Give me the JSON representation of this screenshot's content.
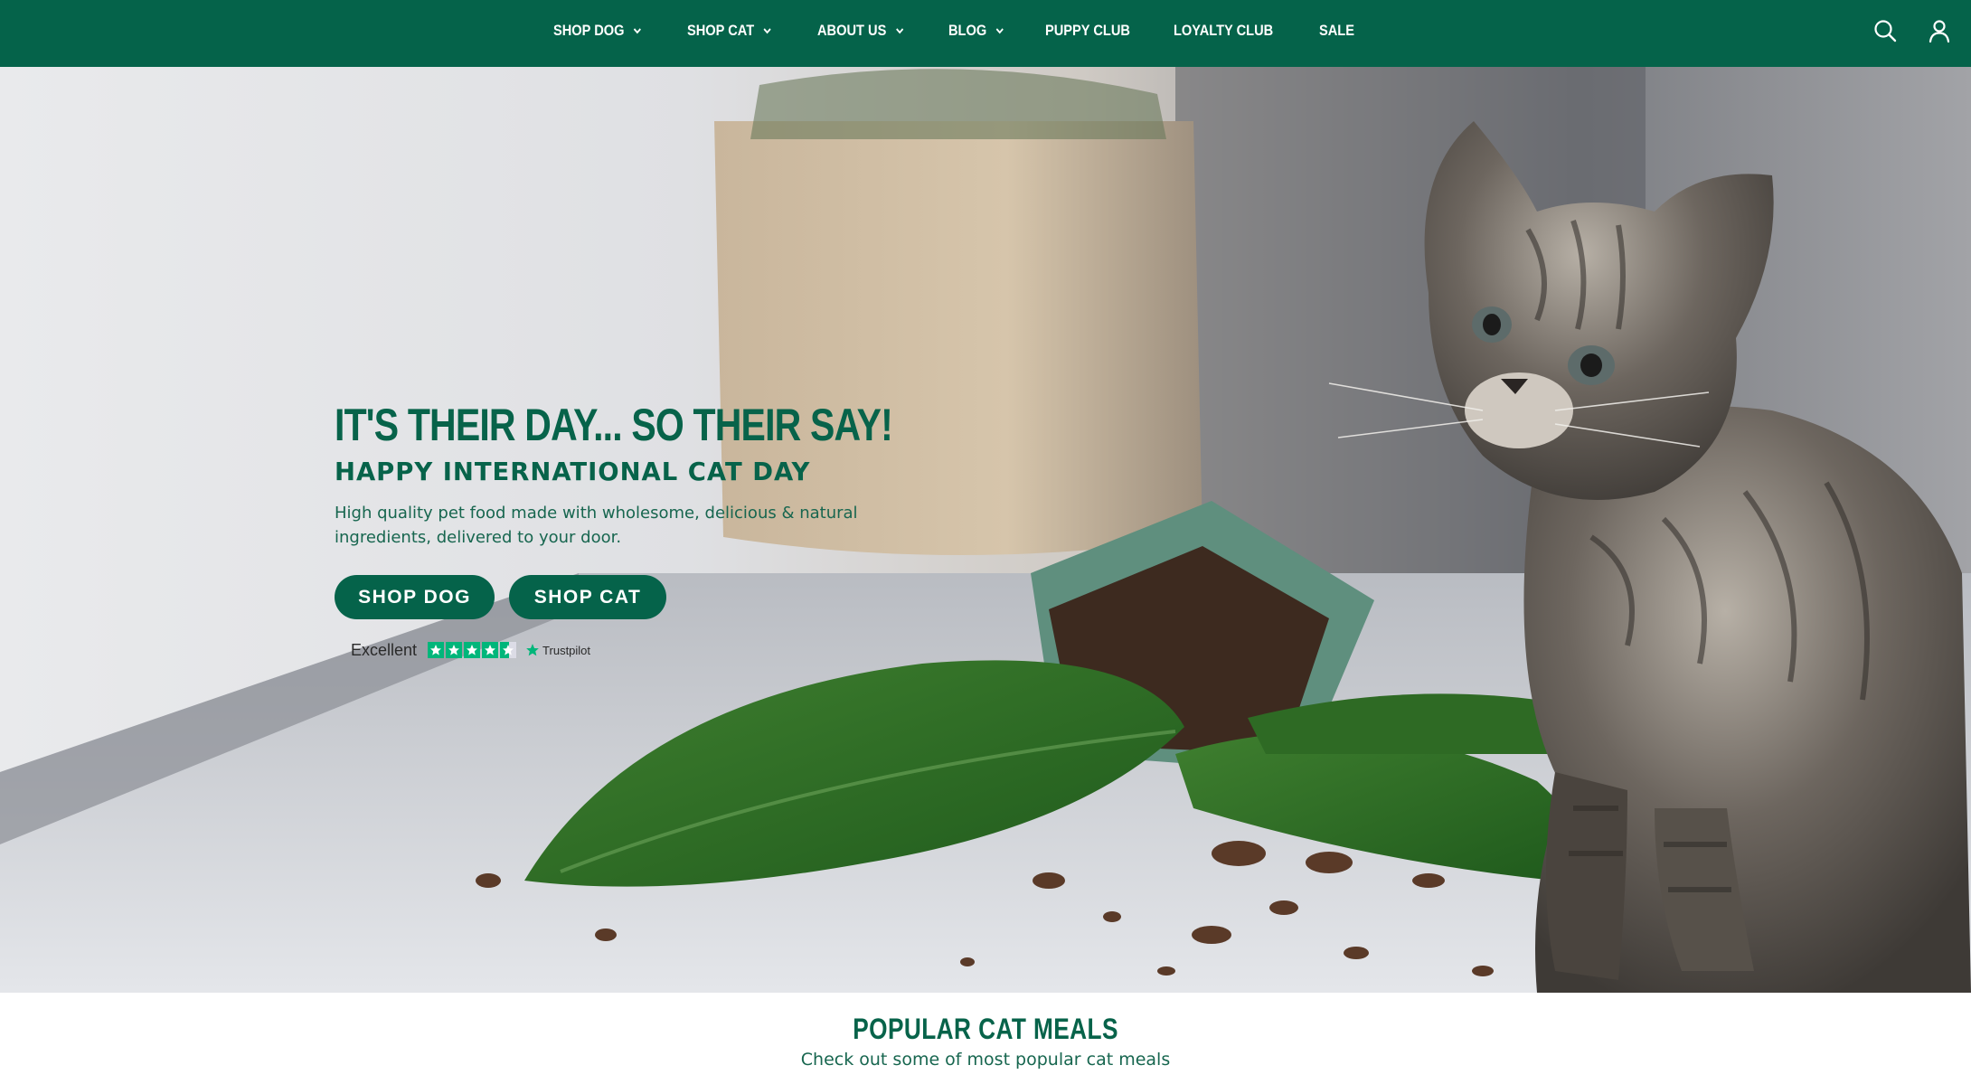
{
  "header": {
    "nav": [
      {
        "label": "SHOP DOG",
        "dropdown": true
      },
      {
        "label": "SHOP CAT",
        "dropdown": true
      },
      {
        "label": "ABOUT US",
        "dropdown": true
      },
      {
        "label": "BLOG",
        "dropdown": true
      },
      {
        "label": "PUPPY CLUB",
        "dropdown": false
      },
      {
        "label": "LOYALTY CLUB",
        "dropdown": false
      },
      {
        "label": "SALE",
        "dropdown": false
      }
    ],
    "icons": [
      "search-icon",
      "account-icon"
    ]
  },
  "hero": {
    "title": "IT'S THEIR DAY... SO THEIR SAY!",
    "subtitle": "HAPPY INTERNATIONAL CAT DAY",
    "description": "High quality pet food made with wholesome, delicious & natural ingredients, delivered to your door.",
    "buttons": {
      "shop_dog": "SHOP DOG",
      "shop_cat": "SHOP CAT"
    },
    "trustpilot": {
      "rating_label": "Excellent",
      "brand": "Trustpilot",
      "stars": 4.5
    }
  },
  "popular": {
    "title": "POPULAR CAT MEALS",
    "subtitle": "Check out some of most popular cat meals"
  },
  "colors": {
    "brand_green": "#05634a",
    "trustpilot_green": "#00b67a",
    "white": "#ffffff"
  }
}
